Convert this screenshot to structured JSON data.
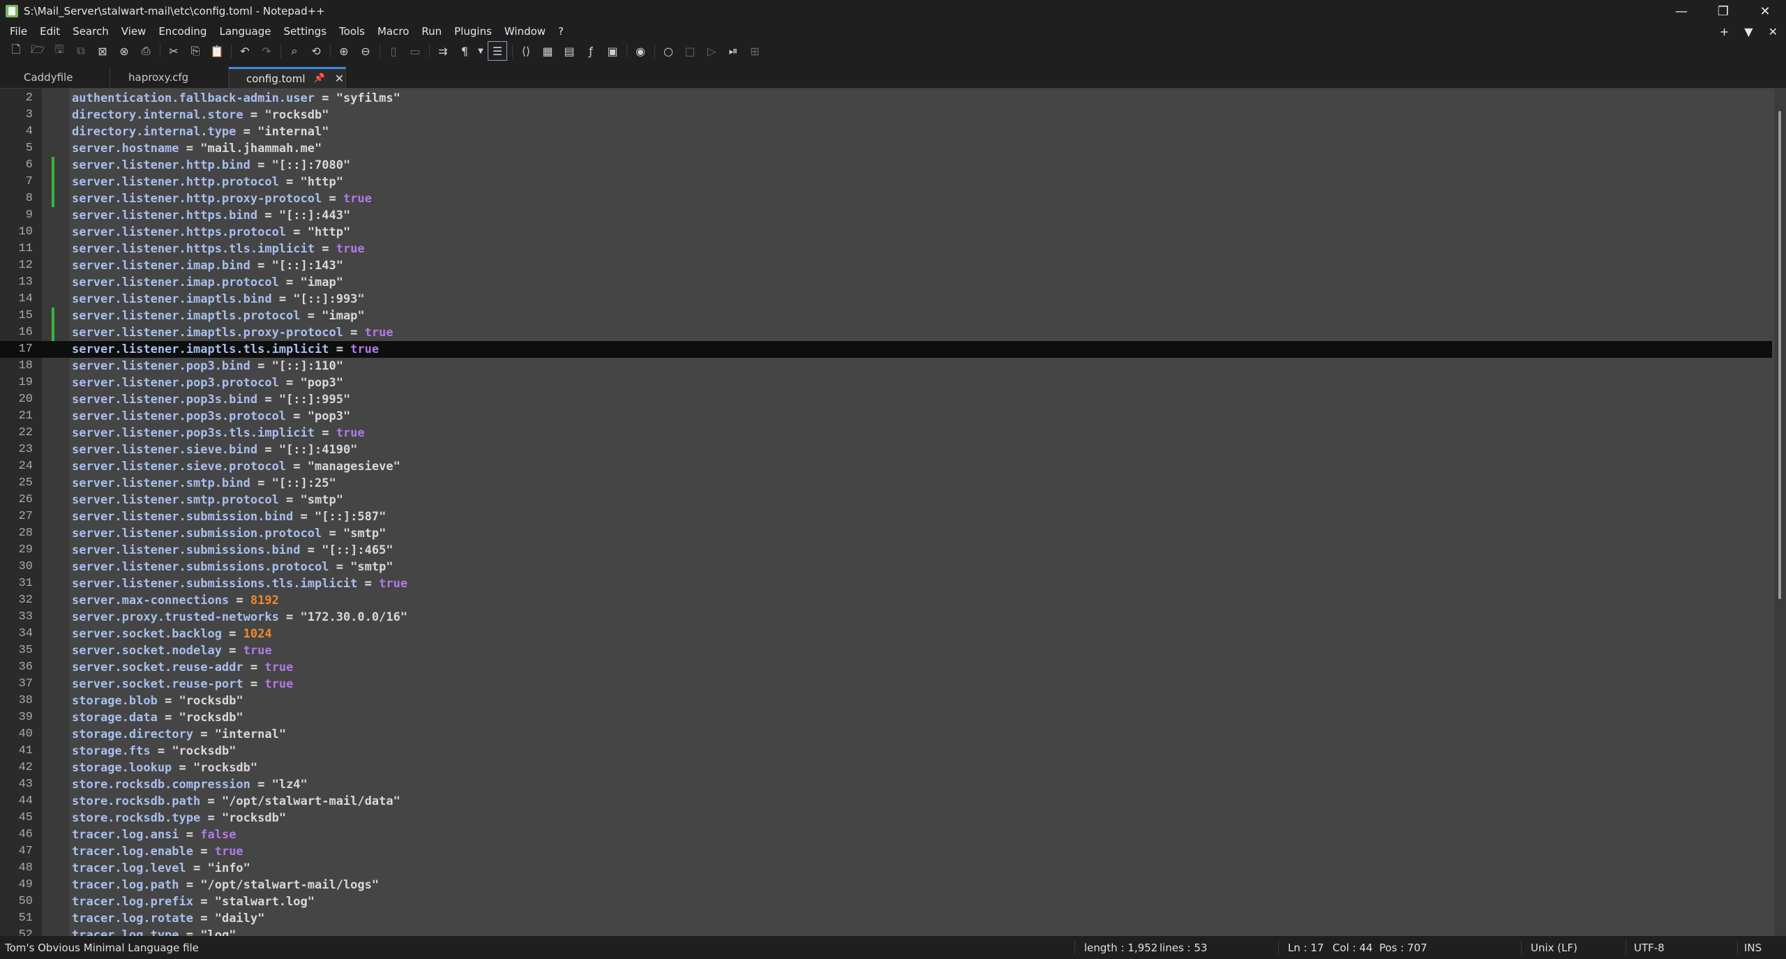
{
  "window": {
    "title": "S:\\Mail_Server\\stalwart-mail\\etc\\config.toml - Notepad++",
    "controls": [
      "—",
      "❐",
      "✕"
    ]
  },
  "menu": {
    "items": [
      "File",
      "Edit",
      "Search",
      "View",
      "Encoding",
      "Language",
      "Settings",
      "Tools",
      "Macro",
      "Run",
      "Plugins",
      "Window",
      "?"
    ],
    "right": [
      "+",
      "▼",
      "✕"
    ]
  },
  "toolbar": {
    "icons": [
      "new-file-icon",
      "open-file-icon",
      "save-icon",
      "save-all-icon",
      "close-icon",
      "close-all-icon",
      "print-icon",
      "cut-icon",
      "copy-icon",
      "paste-icon",
      "undo-icon",
      "redo-icon",
      "find-icon",
      "replace-icon",
      "zoom-in-icon",
      "zoom-out-icon",
      "sync-vertical-icon",
      "sync-horizontal-icon",
      "word-wrap-icon",
      "show-all-chars-icon",
      "indent-guide-icon",
      "xml-tag-icon",
      "doc-map-icon",
      "doc-list-icon",
      "function-list-icon",
      "folder-workspace-icon",
      "monitoring-icon",
      "record-macro-icon",
      "stop-macro-icon",
      "play-macro-icon",
      "run-macro-multiple-icon",
      "save-macro-icon"
    ]
  },
  "tabs": [
    {
      "label": "Caddyfile",
      "active": false
    },
    {
      "label": "haproxy.cfg",
      "active": false
    },
    {
      "label": "config.toml",
      "active": true
    }
  ],
  "editor": {
    "current_line": 17,
    "changed_lines": [
      6,
      7,
      8,
      15,
      16
    ],
    "lines": [
      {
        "n": "2",
        "key": "authentication.fallback-admin.user",
        "val": "\"syfilms\"",
        "type": "s"
      },
      {
        "n": "3",
        "key": "directory.internal.store",
        "val": "\"rocksdb\"",
        "type": "s"
      },
      {
        "n": "4",
        "key": "directory.internal.type",
        "val": "\"internal\"",
        "type": "s"
      },
      {
        "n": "5",
        "key": "server.hostname",
        "val": "\"mail.jhammah.me\"",
        "type": "s"
      },
      {
        "n": "6",
        "key": "server.listener.http.bind",
        "val": "\"[::]:7080\"",
        "type": "s"
      },
      {
        "n": "7",
        "key": "server.listener.http.protocol",
        "val": "\"http\"",
        "type": "s"
      },
      {
        "n": "8",
        "key": "server.listener.http.proxy-protocol",
        "val": "true",
        "type": "b"
      },
      {
        "n": "9",
        "key": "server.listener.https.bind",
        "val": "\"[::]:443\"",
        "type": "s"
      },
      {
        "n": "10",
        "key": "server.listener.https.protocol",
        "val": "\"http\"",
        "type": "s"
      },
      {
        "n": "11",
        "key": "server.listener.https.tls.implicit",
        "val": "true",
        "type": "b"
      },
      {
        "n": "12",
        "key": "server.listener.imap.bind",
        "val": "\"[::]:143\"",
        "type": "s"
      },
      {
        "n": "13",
        "key": "server.listener.imap.protocol",
        "val": "\"imap\"",
        "type": "s"
      },
      {
        "n": "14",
        "key": "server.listener.imaptls.bind",
        "val": "\"[::]:993\"",
        "type": "s"
      },
      {
        "n": "15",
        "key": "server.listener.imaptls.protocol",
        "val": "\"imap\"",
        "type": "s"
      },
      {
        "n": "16",
        "key": "server.listener.imaptls.proxy-protocol",
        "val": "true",
        "type": "b"
      },
      {
        "n": "17",
        "key": "server.listener.imaptls.tls.implicit",
        "val": "true",
        "type": "b"
      },
      {
        "n": "18",
        "key": "server.listener.pop3.bind",
        "val": "\"[::]:110\"",
        "type": "s"
      },
      {
        "n": "19",
        "key": "server.listener.pop3.protocol",
        "val": "\"pop3\"",
        "type": "s"
      },
      {
        "n": "20",
        "key": "server.listener.pop3s.bind",
        "val": "\"[::]:995\"",
        "type": "s"
      },
      {
        "n": "21",
        "key": "server.listener.pop3s.protocol",
        "val": "\"pop3\"",
        "type": "s"
      },
      {
        "n": "22",
        "key": "server.listener.pop3s.tls.implicit",
        "val": "true",
        "type": "b"
      },
      {
        "n": "23",
        "key": "server.listener.sieve.bind",
        "val": "\"[::]:4190\"",
        "type": "s"
      },
      {
        "n": "24",
        "key": "server.listener.sieve.protocol",
        "val": "\"managesieve\"",
        "type": "s"
      },
      {
        "n": "25",
        "key": "server.listener.smtp.bind",
        "val": "\"[::]:25\"",
        "type": "s"
      },
      {
        "n": "26",
        "key": "server.listener.smtp.protocol",
        "val": "\"smtp\"",
        "type": "s"
      },
      {
        "n": "27",
        "key": "server.listener.submission.bind",
        "val": "\"[::]:587\"",
        "type": "s"
      },
      {
        "n": "28",
        "key": "server.listener.submission.protocol",
        "val": "\"smtp\"",
        "type": "s"
      },
      {
        "n": "29",
        "key": "server.listener.submissions.bind",
        "val": "\"[::]:465\"",
        "type": "s"
      },
      {
        "n": "30",
        "key": "server.listener.submissions.protocol",
        "val": "\"smtp\"",
        "type": "s"
      },
      {
        "n": "31",
        "key": "server.listener.submissions.tls.implicit",
        "val": "true",
        "type": "b"
      },
      {
        "n": "32",
        "key": "server.max-connections",
        "val": "8192",
        "type": "n"
      },
      {
        "n": "33",
        "key": "server.proxy.trusted-networks",
        "val": "\"172.30.0.0/16\"",
        "type": "s"
      },
      {
        "n": "34",
        "key": "server.socket.backlog",
        "val": "1024",
        "type": "n"
      },
      {
        "n": "35",
        "key": "server.socket.nodelay",
        "val": "true",
        "type": "b"
      },
      {
        "n": "36",
        "key": "server.socket.reuse-addr",
        "val": "true",
        "type": "b"
      },
      {
        "n": "37",
        "key": "server.socket.reuse-port",
        "val": "true",
        "type": "b"
      },
      {
        "n": "38",
        "key": "storage.blob",
        "val": "\"rocksdb\"",
        "type": "s"
      },
      {
        "n": "39",
        "key": "storage.data",
        "val": "\"rocksdb\"",
        "type": "s"
      },
      {
        "n": "40",
        "key": "storage.directory",
        "val": "\"internal\"",
        "type": "s"
      },
      {
        "n": "41",
        "key": "storage.fts",
        "val": "\"rocksdb\"",
        "type": "s"
      },
      {
        "n": "42",
        "key": "storage.lookup",
        "val": "\"rocksdb\"",
        "type": "s"
      },
      {
        "n": "43",
        "key": "store.rocksdb.compression",
        "val": "\"lz4\"",
        "type": "s"
      },
      {
        "n": "44",
        "key": "store.rocksdb.path",
        "val": "\"/opt/stalwart-mail/data\"",
        "type": "s"
      },
      {
        "n": "45",
        "key": "store.rocksdb.type",
        "val": "\"rocksdb\"",
        "type": "s"
      },
      {
        "n": "46",
        "key": "tracer.log.ansi",
        "val": "false",
        "type": "b"
      },
      {
        "n": "47",
        "key": "tracer.log.enable",
        "val": "true",
        "type": "b"
      },
      {
        "n": "48",
        "key": "tracer.log.level",
        "val": "\"info\"",
        "type": "s"
      },
      {
        "n": "49",
        "key": "tracer.log.path",
        "val": "\"/opt/stalwart-mail/logs\"",
        "type": "s"
      },
      {
        "n": "50",
        "key": "tracer.log.prefix",
        "val": "\"stalwart.log\"",
        "type": "s"
      },
      {
        "n": "51",
        "key": "tracer.log.rotate",
        "val": "\"daily\"",
        "type": "s"
      },
      {
        "n": "52",
        "key": "tracer.log.type",
        "val": "\"log\"",
        "type": "s"
      }
    ]
  },
  "statusbar": {
    "language": "Tom's Obvious Minimal Language file",
    "length": "length : 1,952",
    "lines": "lines : 53",
    "ln": "Ln : 17",
    "col": "Col : 44",
    "pos": "Pos : 707",
    "eol": "Unix (LF)",
    "encoding": "UTF-8",
    "mode": "INS"
  },
  "colors": {
    "key": "#a8bfee",
    "string": "#d8d8d8",
    "boolean": "#b07ae8",
    "number": "#f08a2a",
    "change_marker": "#38b53c"
  }
}
